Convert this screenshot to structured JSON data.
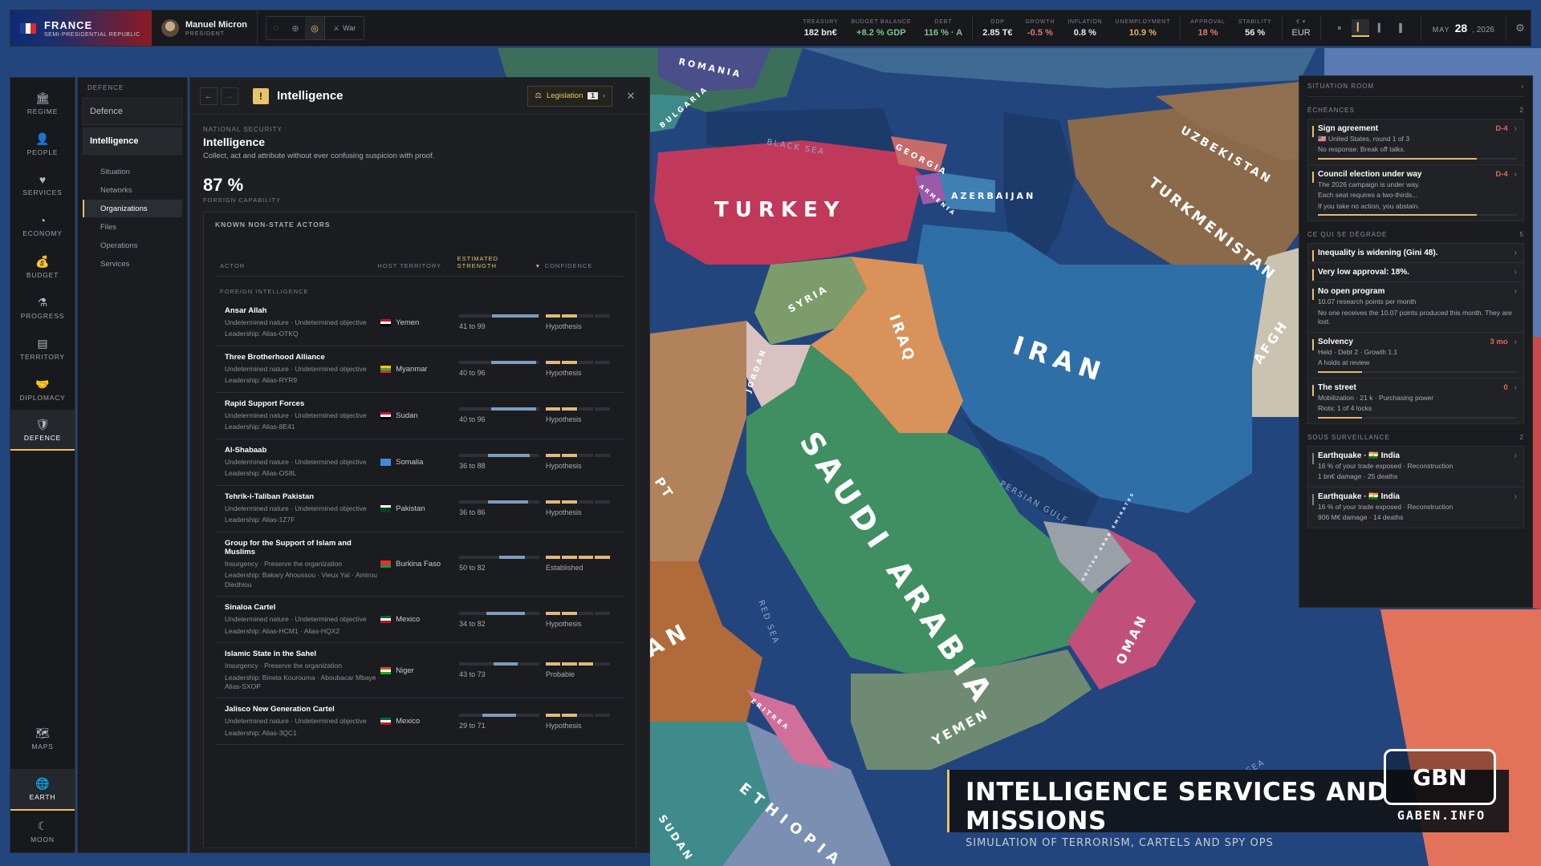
{
  "topbar": {
    "country": "FRANCE",
    "regime": "SEMI-PRESIDENTIAL REPUBLIC",
    "flag_colors": [
      "#1f3f9a",
      "#ffffff",
      "#d92b34"
    ],
    "leader_name": "Manuel Micron",
    "leader_role": "PRESIDENT",
    "war_label": "War",
    "stats": [
      {
        "label": "TREASURY",
        "value": "182 bn€",
        "tone": ""
      },
      {
        "label": "BUDGET BALANCE",
        "value": "+8.2 % GDP",
        "tone": "pos"
      },
      {
        "label": "DEBT",
        "value": "116 % · A",
        "tone": "pos"
      },
      {
        "label": "GDP",
        "value": "2.85 T€",
        "tone": ""
      },
      {
        "label": "GROWTH",
        "value": "-0.5 %",
        "tone": "neg"
      },
      {
        "label": "INFLATION",
        "value": "0.8 %",
        "tone": ""
      },
      {
        "label": "UNEMPLOYMENT",
        "value": "10.9 %",
        "tone": "warn"
      },
      {
        "label": "APPROVAL",
        "value": "18 %",
        "tone": "neg"
      },
      {
        "label": "STABILITY",
        "value": "56 %",
        "tone": ""
      }
    ],
    "currency_label": "€ ▾",
    "currency": "EUR",
    "date_month": "MAY",
    "date_day": "28",
    "date_year": ", 2026"
  },
  "leftnav": {
    "items": [
      {
        "label": "REGIME",
        "icon": "🏛"
      },
      {
        "label": "PEOPLE",
        "icon": "👤"
      },
      {
        "label": "SERVICES",
        "icon": "♥"
      },
      {
        "label": "ECONOMY",
        "icon": "◔"
      },
      {
        "label": "BUDGET",
        "icon": "💰"
      },
      {
        "label": "PROGRESS",
        "icon": "⚗"
      },
      {
        "label": "TERRITORY",
        "icon": "▤"
      },
      {
        "label": "DIPLOMACY",
        "icon": "🤝"
      },
      {
        "label": "DEFENCE",
        "icon": "🛡"
      }
    ],
    "bottom": [
      {
        "label": "MAPS",
        "icon": "🗺"
      },
      {
        "label": "EARTH",
        "icon": "🌐"
      },
      {
        "label": "MOON",
        "icon": "☾"
      }
    ]
  },
  "subnav": {
    "heading": "DEFENCE",
    "defence": "Defence",
    "intelligence": "Intelligence",
    "children": [
      "Situation",
      "Networks",
      "Organizations",
      "Files",
      "Operations",
      "Services"
    ]
  },
  "panel": {
    "title": "Intelligence",
    "legislation_label": "Legislation",
    "legislation_count": "1",
    "section_label": "NATIONAL SECURITY",
    "section_title": "Intelligence",
    "section_desc": "Collect, act and attribute without ever confusing suspicion with proof.",
    "capability_value": "87 %",
    "capability_label": "FOREIGN CAPABILITY",
    "box_title": "KNOWN NON-STATE ACTORS",
    "columns": {
      "actor": "ACTOR",
      "host": "HOST TERRITORY",
      "strength_1": "ESTIMATED",
      "strength_2": "STRENGTH",
      "confidence": "CONFIDENCE"
    },
    "group_label": "FOREIGN INTELLIGENCE",
    "actors": [
      {
        "name": "Ansar Allah",
        "desc": "Undetermined nature · Undetermined objective",
        "lead": "Leadership: Alias-OTKQ",
        "host": "Yemen",
        "flag": [
          "#ce1126",
          "#ffffff",
          "#000000"
        ],
        "min": 41,
        "max": 99,
        "range": "41 to 99",
        "confidence_level": 2,
        "confidence": "Hypothesis"
      },
      {
        "name": "Three Brotherhood Alliance",
        "desc": "Undetermined nature · Undetermined objective",
        "lead": "Leadership: Alias-RYR9",
        "host": "Myanmar",
        "flag": [
          "#fecb00",
          "#34b233",
          "#ea2839"
        ],
        "min": 40,
        "max": 96,
        "range": "40 to 96",
        "confidence_level": 2,
        "confidence": "Hypothesis"
      },
      {
        "name": "Rapid Support Forces",
        "desc": "Undetermined nature · Undetermined objective",
        "lead": "Leadership: Alias-8E41",
        "host": "Sudan",
        "flag": [
          "#d21034",
          "#ffffff",
          "#000000"
        ],
        "min": 40,
        "max": 96,
        "range": "40 to 96",
        "confidence_level": 2,
        "confidence": "Hypothesis"
      },
      {
        "name": "Al-Shabaab",
        "desc": "Undetermined nature · Undetermined objective",
        "lead": "Leadership: Alias-OS8L",
        "host": "Somalia",
        "flag": [
          "#4189dd",
          "#4189dd",
          "#4189dd"
        ],
        "min": 36,
        "max": 88,
        "range": "36 to 88",
        "confidence_level": 2,
        "confidence": "Hypothesis"
      },
      {
        "name": "Tehrik-i-Taliban Pakistan",
        "desc": "Undetermined nature · Undetermined objective",
        "lead": "Leadership: Alias-1Z7F",
        "host": "Pakistan",
        "flag": [
          "#ffffff",
          "#01411c",
          "#01411c"
        ],
        "min": 36,
        "max": 86,
        "range": "36 to 86",
        "confidence_level": 2,
        "confidence": "Hypothesis"
      },
      {
        "name": "Group for the Support of Islam and Muslims",
        "desc": "Insurgency · Preserve the organization",
        "lead": "Leadership: Bakary Ahoussou · Vieux Yaï · Amirou Diedhiou",
        "host": "Burkina Faso",
        "flag": [
          "#ef2b2d",
          "#ef2b2d",
          "#009e49"
        ],
        "min": 50,
        "max": 82,
        "range": "50 to 82",
        "confidence_level": 4,
        "confidence": "Established"
      },
      {
        "name": "Sinaloa Cartel",
        "desc": "Undetermined nature · Undetermined objective",
        "lead": "Leadership: Alias-HCM1 · Alias-HQX2",
        "host": "Mexico",
        "flag": [
          "#006847",
          "#ffffff",
          "#ce1126"
        ],
        "min": 34,
        "max": 82,
        "range": "34 to 82",
        "confidence_level": 2,
        "confidence": "Hypothesis"
      },
      {
        "name": "Islamic State in the Sahel",
        "desc": "Insurgency · Preserve the organization",
        "lead": "Leadership: Bineta Kourouma · Aboubacar Mbaye · Alias-SXOP",
        "host": "Niger",
        "flag": [
          "#e05206",
          "#ffffff",
          "#0db02b"
        ],
        "min": 43,
        "max": 73,
        "range": "43 to 73",
        "confidence_level": 3,
        "confidence": "Probable"
      },
      {
        "name": "Jalisco New Generation Cartel",
        "desc": "Undetermined nature · Undetermined objective",
        "lead": "Leadership: Alias-3QC1",
        "host": "Mexico",
        "flag": [
          "#006847",
          "#ffffff",
          "#ce1126"
        ],
        "min": 29,
        "max": 71,
        "range": "29 to 71",
        "confidence_level": 2,
        "confidence": "Hypothesis"
      }
    ]
  },
  "situation_room": {
    "title": "SITUATION ROOM",
    "sections": [
      {
        "label": "ÉCHÉANCES",
        "count": "2",
        "cards": [
          {
            "title": "Sign agreement",
            "right": "D-4",
            "lines": [
              "🇺🇸 United States, round 1 of 3",
              "No response: Break off talks."
            ],
            "bar": 0.8
          },
          {
            "title": "Council election under way",
            "right": "D-4",
            "lines": [
              "The 2026 campaign is under way.",
              "Each seat requires a two-thirds...",
              "If you take no action, you abstain."
            ],
            "bar": 0.8
          }
        ]
      },
      {
        "label": "CE QUI SE DÉGRADE",
        "count": "5",
        "cards": [
          {
            "title": "Inequality is widening (Gini 48).",
            "right": "",
            "lines": [],
            "bar": null
          },
          {
            "title": "Very low approval: 18%.",
            "right": "",
            "lines": [],
            "bar": null
          },
          {
            "title": "No open program",
            "right": "",
            "lines": [
              "10.07 research points per month",
              "No one receives the 10.07 points produced this month. They are lost."
            ],
            "bar": null
          },
          {
            "title": "Solvency",
            "right": "3 mo",
            "lines": [
              "Held · Debt 2 · Growth 1.1",
              "A holds at review"
            ],
            "bar": 0.22
          },
          {
            "title": "The street",
            "right": "0",
            "lines": [
              "Mobilization · 21 k · Purchasing power",
              "Riots: 1 of 4 locks"
            ],
            "bar": 0.22
          }
        ]
      },
      {
        "label": "SOUS SURVEILLANCE",
        "count": "2",
        "cards": [
          {
            "title": "Earthquake · 🇮🇳 India",
            "right": "",
            "lines": [
              "16 % of your trade exposed · Reconstruction",
              "1 bn€ damage · 25 deaths"
            ],
            "bar": null
          },
          {
            "title": "Earthquake · 🇮🇳 India",
            "right": "",
            "lines": [
              "16 % of your trade exposed · Reconstruction",
              "906 M€ damage · 14 deaths"
            ],
            "bar": null
          }
        ]
      }
    ]
  },
  "map": {
    "labels": [
      "TURKEY",
      "IRAN",
      "IRAQ",
      "SYRIA",
      "SAUDI ARABIA",
      "YEMEN",
      "OMAN",
      "TURKMENISTAN",
      "UZBEKISTAN",
      "AZERBAIJAN",
      "GEORGIA",
      "ARMENIA",
      "ROMANIA",
      "BULGARIA",
      "JORDAN",
      "ERITREA",
      "ETHIOPIA",
      "SUDAN",
      "AFGH",
      "AN",
      "PT",
      "UNITED ARAB EMIRATES"
    ],
    "seas": [
      "BLACK SEA",
      "RED SEA",
      "PERSIAN GULF",
      "SEA"
    ]
  },
  "banner": {
    "title": "INTELLIGENCE SERVICES AND MISSIONS",
    "subtitle": "SIMULATION OF TERRORISM, CARTELS AND SPY OPS",
    "logo_text": "GABEN.INFO"
  }
}
